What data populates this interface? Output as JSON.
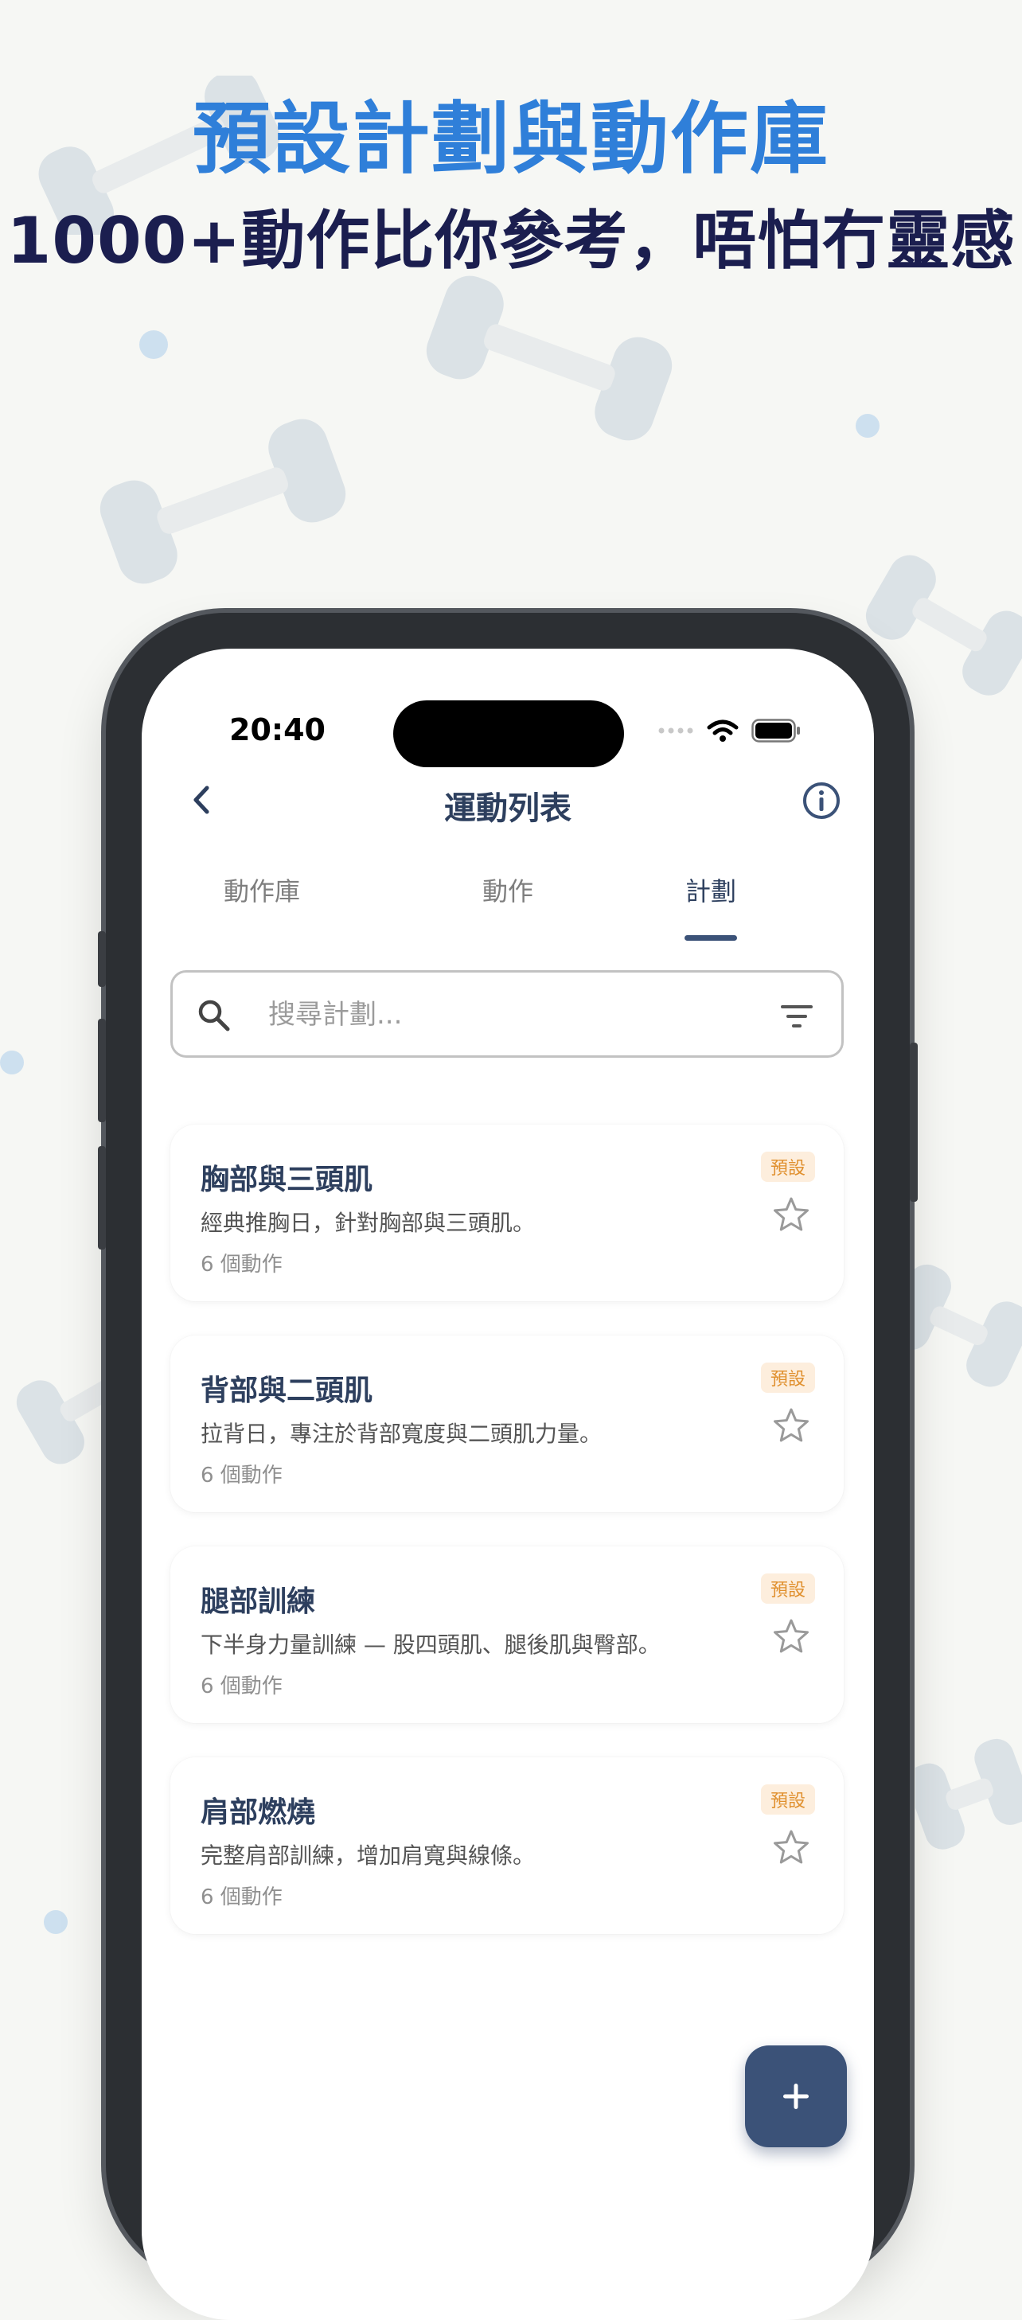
{
  "promo": {
    "headline": "預設計劃與動作庫",
    "subheadline": "1000+動作比你參考，唔怕冇靈感"
  },
  "status_bar": {
    "time": "20:40"
  },
  "nav": {
    "title": "運動列表"
  },
  "tabs": [
    {
      "label": "動作庫",
      "active": false
    },
    {
      "label": "動作",
      "active": false
    },
    {
      "label": "計劃",
      "active": true
    }
  ],
  "search": {
    "placeholder": "搜尋計劃..."
  },
  "plans": [
    {
      "title": "胸部與三頭肌",
      "description": "經典推胸日，針對胸部與三頭肌。",
      "count": "6 個動作",
      "badge": "預設",
      "favorited": false
    },
    {
      "title": "背部與二頭肌",
      "description": "拉背日，專注於背部寬度與二頭肌力量。",
      "count": "6 個動作",
      "badge": "預設",
      "favorited": false
    },
    {
      "title": "腿部訓練",
      "description": "下半身力量訓練 — 股四頭肌、腿後肌與臀部。",
      "count": "6 個動作",
      "badge": "預設",
      "favorited": false
    },
    {
      "title": "肩部燃燒",
      "description": "完整肩部訓練，增加肩寬與線條。",
      "count": "6 個動作",
      "badge": "預設",
      "favorited": false
    }
  ],
  "icons": {
    "back": "chevron-left-icon",
    "info": "info-icon",
    "search": "search-icon",
    "filter": "filter-icon",
    "favorite": "star-outline-icon",
    "add": "plus-icon"
  },
  "colors": {
    "headline": "#2f7fd9",
    "subheadline": "#1b1e4f",
    "primary": "#3b5278",
    "badge_bg": "#fdeedd",
    "badge_text": "#e0902e"
  }
}
